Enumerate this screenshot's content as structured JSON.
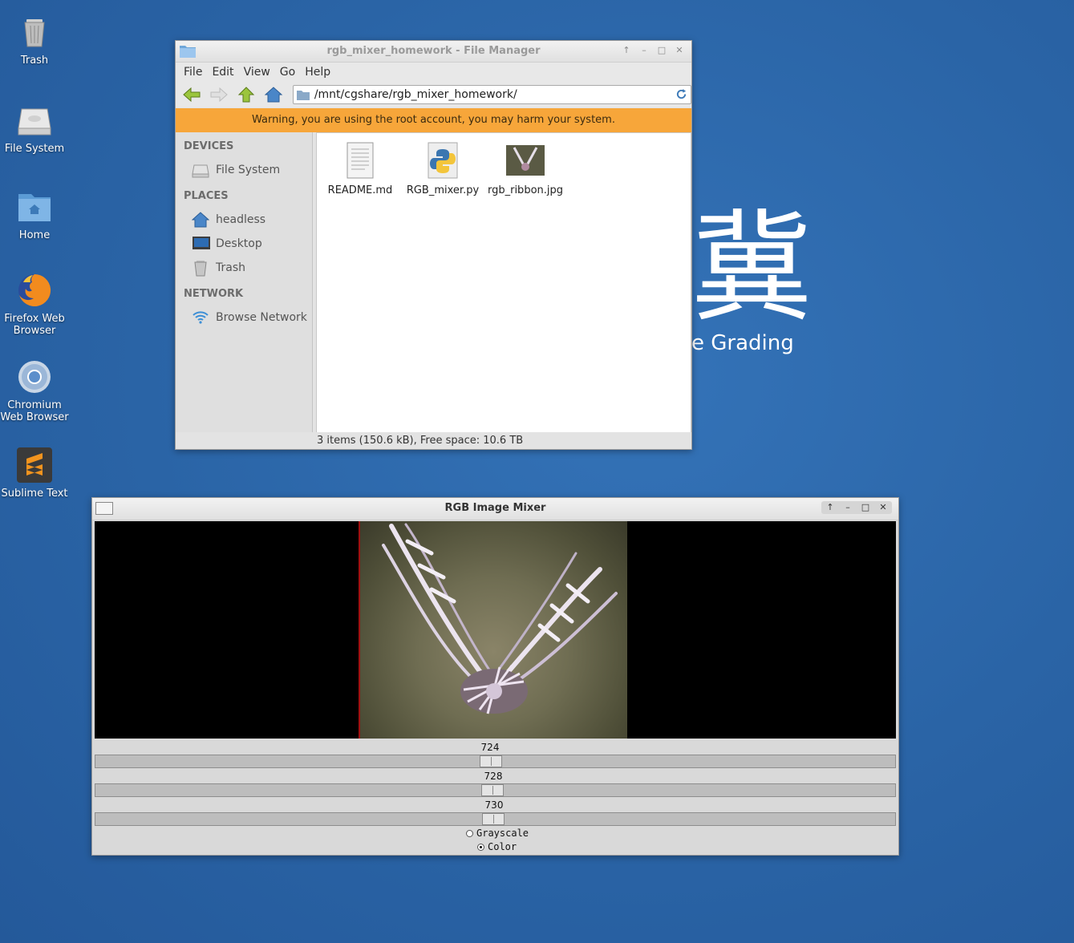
{
  "desktop": {
    "icons": [
      {
        "label": "Trash"
      },
      {
        "label": "File System"
      },
      {
        "label": "Home"
      },
      {
        "label": "Firefox Web Browser"
      },
      {
        "label": "Chromium Web Browser"
      },
      {
        "label": "Sublime Text"
      }
    ],
    "wallpaper_glyphs": "冀",
    "wallpaper_text": "e Grading"
  },
  "file_manager": {
    "title": "rgb_mixer_homework - File Manager",
    "menu": [
      "File",
      "Edit",
      "View",
      "Go",
      "Help"
    ],
    "path": "/mnt/cgshare/rgb_mixer_homework/",
    "warning": "Warning, you are using the root account, you may harm your system.",
    "sidebar": {
      "devices_header": "DEVICES",
      "devices": [
        {
          "label": "File System"
        }
      ],
      "places_header": "PLACES",
      "places": [
        {
          "label": "headless"
        },
        {
          "label": "Desktop"
        },
        {
          "label": "Trash"
        }
      ],
      "network_header": "NETWORK",
      "network": [
        {
          "label": "Browse Network"
        }
      ]
    },
    "files": [
      {
        "name": "README.md"
      },
      {
        "name": "RGB_mixer.py"
      },
      {
        "name": "rgb_ribbon.jpg"
      }
    ],
    "status": "3 items (150.6 kB), Free space: 10.6 TB"
  },
  "mixer": {
    "title": "RGB Image Mixer",
    "sliders": [
      {
        "value": "724"
      },
      {
        "value": "728"
      },
      {
        "value": "730"
      }
    ],
    "modes": [
      {
        "label": "Grayscale",
        "selected": false
      },
      {
        "label": "Color",
        "selected": true
      }
    ]
  }
}
